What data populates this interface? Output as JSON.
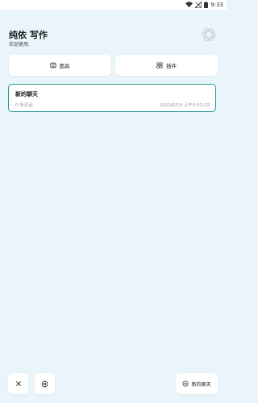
{
  "status_bar": {
    "time": "9:33",
    "icons": [
      "wifi-icon",
      "signal-icon",
      "battery-icon"
    ]
  },
  "header": {
    "title": "纯依 写作",
    "subtitle": "欢迎使用."
  },
  "actions": {
    "masks_label": "面具",
    "plugins_label": "插件"
  },
  "chat_list": [
    {
      "title": "新的聊天",
      "count": "0 条对话",
      "time": "2023/6/19 上午9:33:22"
    }
  ],
  "bottom_bar": {
    "new_chat_label": "新的聊天"
  },
  "colors": {
    "background": "#e9f5fb",
    "accent": "#1f9b8f"
  }
}
